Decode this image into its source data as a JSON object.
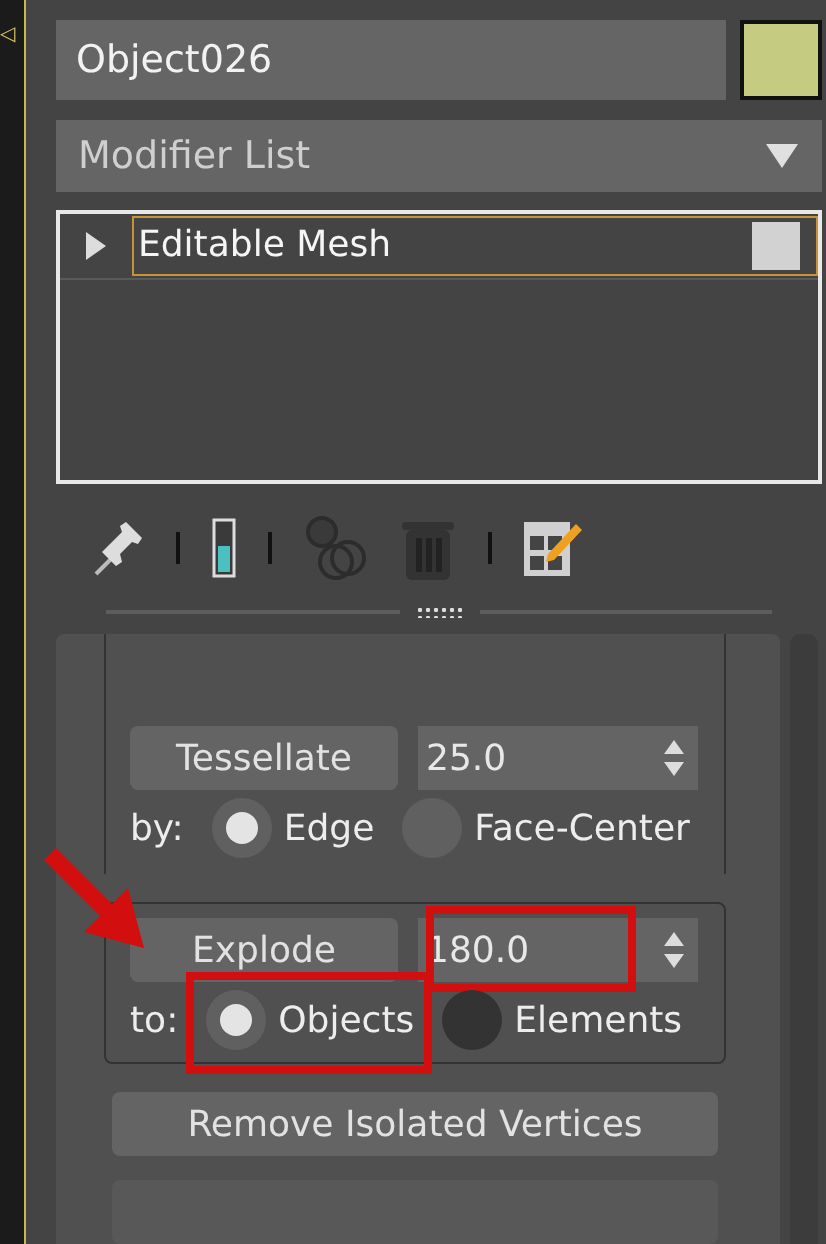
{
  "panel_toggle": "◁",
  "object_name": {
    "value": "Object026",
    "color": "#c5cb80"
  },
  "modifier_dropdown": {
    "label": "Modifier List"
  },
  "modifier_stack": [
    {
      "label": "Editable Mesh",
      "selected": true,
      "expanded": false
    }
  ],
  "tessellate": {
    "button": "Tessellate",
    "value": "25.0",
    "label": "by:",
    "options": [
      {
        "label": "Edge",
        "selected": true
      },
      {
        "label": "Face-Center",
        "selected": false
      }
    ]
  },
  "explode": {
    "button": "Explode",
    "value": "180.0",
    "label": "to:",
    "annotated": true,
    "options": [
      {
        "label": "Objects",
        "selected": true,
        "annotated": true
      },
      {
        "label": "Elements",
        "selected": false
      }
    ]
  },
  "buttons": [
    {
      "label": "Remove Isolated Vertices",
      "disabled": false
    },
    {
      "disabled": true
    }
  ]
}
